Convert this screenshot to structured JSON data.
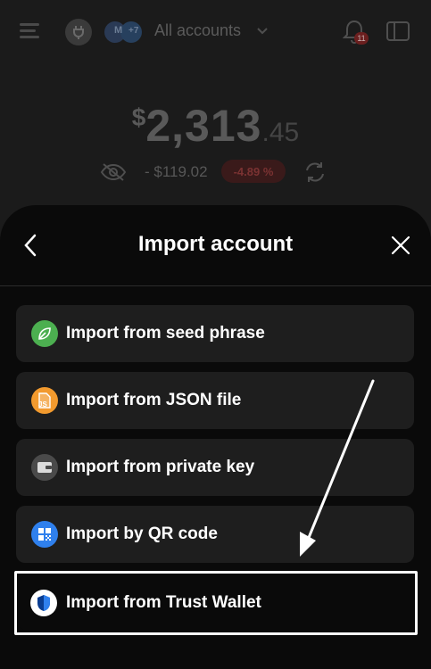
{
  "header": {
    "account_label": "All accounts",
    "avatar_text": "M",
    "avatar_badge": "+7",
    "notification_count": "11"
  },
  "balance": {
    "currency": "$",
    "integer": "2,313",
    "decimal": ".45",
    "change_amount": "- $119.02",
    "change_percent": "-4.89 %"
  },
  "modal": {
    "title": "Import account",
    "options": [
      {
        "label": "Import from seed phrase",
        "icon": "leaf-icon",
        "color": "#4caf50"
      },
      {
        "label": "Import from JSON file",
        "icon": "json-file-icon",
        "color": "#f29a2e"
      },
      {
        "label": "Import from private key",
        "icon": "wallet-icon",
        "color": "#4a4a4a"
      },
      {
        "label": "Import by QR code",
        "icon": "qr-code-icon",
        "color": "#2f80ed"
      },
      {
        "label": "Import from Trust Wallet",
        "icon": "trust-wallet-shield-icon",
        "color": "#ffffff",
        "highlighted": true
      }
    ],
    "json_badge_text": "JS"
  },
  "colors": {
    "sheet_bg": "#0a0a0a",
    "option_bg": "#1e1e1e",
    "negative": "#7a3232"
  }
}
